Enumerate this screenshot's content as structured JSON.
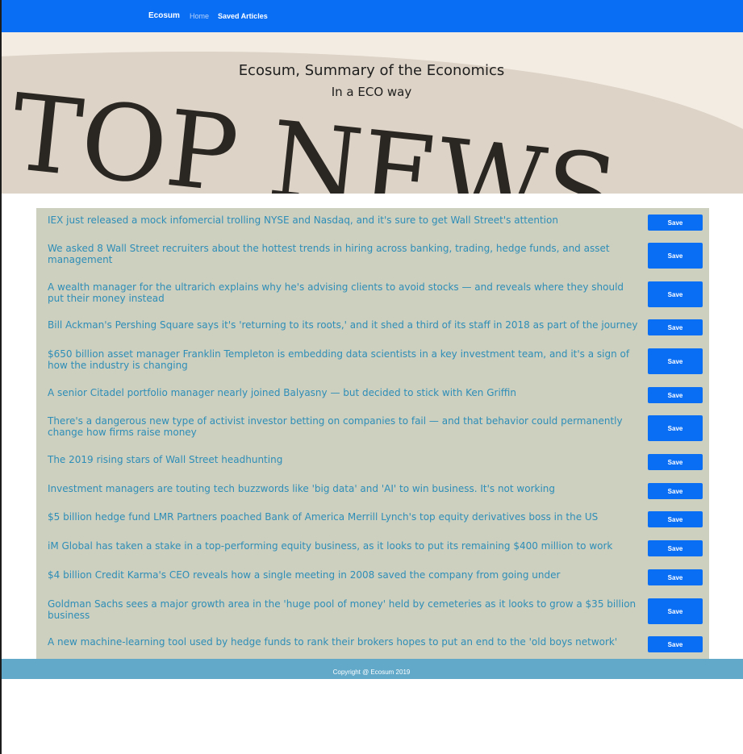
{
  "navbar": {
    "brand": "Ecosum",
    "home": "Home",
    "saved": "Saved Articles"
  },
  "hero": {
    "title": "Ecosum, Summary of the Economics",
    "subtitle": "In a ECO way",
    "banner_text": "TOP NEWS"
  },
  "articles": [
    {
      "title": "IEX just released a mock infomercial trolling NYSE and Nasdaq, and it's sure to get Wall Street's attention",
      "save": "Save"
    },
    {
      "title": "We asked 8 Wall Street recruiters about the hottest trends in hiring across banking, trading, hedge funds, and asset management",
      "save": "Save"
    },
    {
      "title": "A wealth manager for the ultrarich explains why he's advising clients to avoid stocks — and reveals where they should put their money instead",
      "save": "Save"
    },
    {
      "title": "Bill Ackman's Pershing Square says it's 'returning to its roots,' and it shed a third of its staff in 2018 as part of the journey",
      "save": "Save"
    },
    {
      "title": "$650 billion asset manager Franklin Templeton is embedding data scientists in a key investment team, and it's a sign of how the industry is changing",
      "save": "Save"
    },
    {
      "title": "A senior Citadel portfolio manager nearly joined Balyasny — but decided to stick with Ken Griffin",
      "save": "Save"
    },
    {
      "title": "There's a dangerous new type of activist investor betting on companies to fail — and that behavior could permanently change how firms raise money",
      "save": "Save"
    },
    {
      "title": "The 2019 rising stars of Wall Street headhunting",
      "save": "Save"
    },
    {
      "title": "Investment managers are touting tech buzzwords like 'big data' and 'AI' to win business. It's not working",
      "save": "Save"
    },
    {
      "title": "$5 billion hedge fund LMR Partners poached Bank of America Merrill Lynch's top equity derivatives boss in the US",
      "save": "Save"
    },
    {
      "title": "iM Global has taken a stake in a top-performing equity business, as it looks to put its remaining $400 million to work",
      "save": "Save"
    },
    {
      "title": "$4 billion Credit Karma's CEO reveals how a single meeting in 2008 saved the company from going under",
      "save": "Save"
    },
    {
      "title": "Goldman Sachs sees a major growth area in the 'huge pool of money' held by cemeteries as it looks to grow a $35 billion business",
      "save": "Save"
    },
    {
      "title": "A new machine-learning tool used by hedge funds to rank their brokers hopes to put an end to the 'old boys network'",
      "save": "Save"
    }
  ],
  "footer": {
    "text": "Copyright @ Ecosum 2019"
  },
  "colors": {
    "navbar": "#0a6ef5",
    "button": "#0a6ef5",
    "article_text": "#2e8eb7",
    "article_bg": "#cdcfbf",
    "footer": "#61a8c9"
  }
}
